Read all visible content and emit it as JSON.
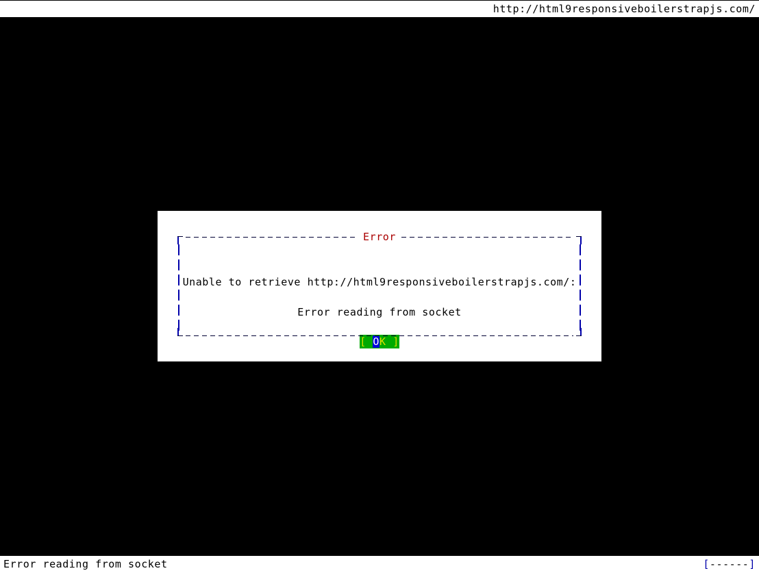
{
  "browser": {
    "name": "terminal-text-browser",
    "url_bar": {
      "url": "http://html9responsiveboilerstrapjs.com/"
    },
    "status_bar": {
      "message": "Error reading from socket",
      "progress_open_bracket": "[",
      "progress_dashes": "------",
      "progress_close_bracket": "]"
    }
  },
  "dialog": {
    "title": "Error",
    "message": "Unable to retrieve http://html9responsiveboilerstrapjs.com/:",
    "detail": "Error reading from socket",
    "buttons": [
      {
        "label": "OK",
        "open_bracket": "[",
        "close_bracket": "]",
        "space": " ",
        "highlight_char": "O",
        "rest_char": "K",
        "focused": true
      }
    ]
  },
  "colors": {
    "screen_background": "#000000",
    "bar_background": "#ffffff",
    "bar_text": "#000000",
    "dialog_background": "#ffffff",
    "dialog_border": "#0000aa",
    "dialog_dash": "#000033",
    "dialog_title": "#aa0000",
    "button_background": "#00aa00",
    "button_bracket": "#dddd00",
    "button_cursor_background": "#0000dd",
    "button_cursor_text": "#ffffff"
  }
}
